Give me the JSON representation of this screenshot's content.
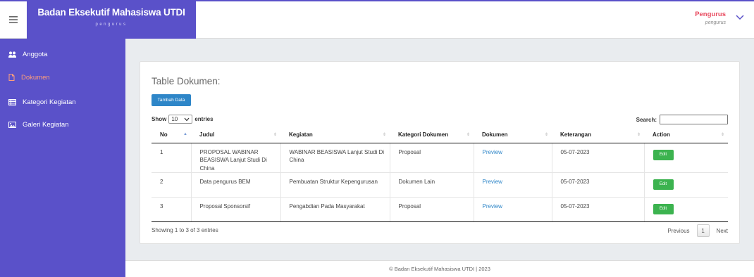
{
  "brand": {
    "title": "Badan Eksekutif Mahasiswa UTDI",
    "subtitle": "pengurus"
  },
  "user": {
    "name": "Pengurus",
    "role": "pengurus"
  },
  "sidebar": {
    "items": [
      {
        "label": "Anggota",
        "icon": "users-icon"
      },
      {
        "label": "Dokumen",
        "icon": "document-icon",
        "active": true
      },
      {
        "label": "Kategori Kegiatan",
        "icon": "list-icon"
      },
      {
        "label": "Galeri Kegiatan",
        "icon": "image-icon"
      }
    ]
  },
  "main": {
    "title": "Table Dokumen:",
    "add_label": "Tambah Data",
    "length": {
      "prefix": "Show",
      "value": "10",
      "suffix": "entries"
    },
    "search_label": "Search:",
    "columns": [
      "No",
      "Judul",
      "Kegiatan",
      "Kategori Dokumen",
      "Dokumen",
      "Keterangan",
      "Action"
    ],
    "rows": [
      {
        "no": "1",
        "judul": "PROPOSAL WABINAR BEASISWA Lanjut Studi Di China",
        "kegiatan": "WABINAR BEASISWA Lanjut Studi Di China",
        "kategori": "Proposal",
        "dokumen": "Preview",
        "keterangan": "05-07-2023",
        "action": "Edit"
      },
      {
        "no": "2",
        "judul": "Data pengurus BEM",
        "kegiatan": "Pembuatan Struktur Kepengurusan",
        "kategori": "Dokumen Lain",
        "dokumen": "Preview",
        "keterangan": "05-07-2023",
        "action": "Edit"
      },
      {
        "no": "3",
        "judul": "Proposal Sponsorsif",
        "kegiatan": "Pengabdian Pada Masyarakat",
        "kategori": "Proposal",
        "dokumen": "Preview",
        "keterangan": "05-07-2023",
        "action": "Edit"
      }
    ],
    "info": "Showing 1 to 3 of 3 entries",
    "pagination": {
      "previous": "Previous",
      "page": "1",
      "next": "Next"
    }
  },
  "footer": {
    "text": "© Badan Eksekutif Mahasiswa UTDI | 2023"
  },
  "colors": {
    "brand": "#5a51c9",
    "accent_active": "#ff9e7a",
    "user_name": "#e84a5f",
    "primary_button": "#2e86c8",
    "edit_button": "#3cb34f"
  }
}
